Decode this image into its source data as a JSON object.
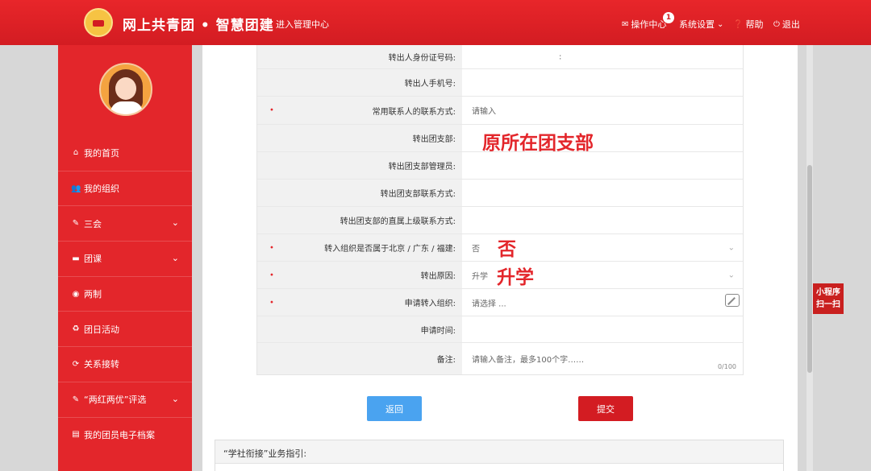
{
  "header": {
    "site_title": "网上共青团 • 智慧团建",
    "enter_admin": "进入管理中心",
    "ops_center": "操作中心",
    "ops_badge": "1",
    "settings": "系统设置",
    "help": "帮助",
    "logout": "退出"
  },
  "sidebar": {
    "items": [
      {
        "label": "我的首页",
        "icon": "home-icon"
      },
      {
        "label": "我的组织",
        "icon": "users-icon"
      },
      {
        "label": "三会",
        "icon": "edit-icon"
      },
      {
        "label": "团课",
        "icon": "folder-icon"
      },
      {
        "label": "两制",
        "icon": "circle-icon"
      },
      {
        "label": "团日活动",
        "icon": "recycle-icon"
      },
      {
        "label": "关系接转",
        "icon": "refresh-icon"
      },
      {
        "label": "“两红两优”评选",
        "icon": "edit-icon"
      },
      {
        "label": "我的团员电子档案",
        "icon": "file-icon"
      }
    ]
  },
  "form": {
    "rows": [
      {
        "label": "转出人身份证号码:",
        "value": ":"
      },
      {
        "label": "转出人手机号:",
        "value": ""
      },
      {
        "label": "常用联系人的联系方式:",
        "value": "请输入",
        "required": true
      },
      {
        "label": "转出团支部:",
        "value": ""
      },
      {
        "label": "转出团支部管理员:",
        "value": ""
      },
      {
        "label": "转出团支部联系方式:",
        "value": ""
      },
      {
        "label": "转出团支部的直属上级联系方式:",
        "value": ""
      },
      {
        "label": "转入组织是否属于北京 / 广东 / 福建:",
        "value": "否",
        "required": true
      },
      {
        "label": "转出原因:",
        "value": "升学",
        "required": true
      },
      {
        "label": "申请转入组织:",
        "value": "请选择 ...",
        "required": true
      },
      {
        "label": "申请时间:",
        "value": ""
      },
      {
        "label": "备注:",
        "value": "请输入备注，最多100个字……"
      }
    ],
    "remark_counter": "0/100",
    "annotations": {
      "branch": "原所在团支部",
      "no": "否",
      "reason": "升学"
    }
  },
  "buttons": {
    "back": "返回",
    "submit": "提交"
  },
  "guide": {
    "title": "“学社衔接”业务指引:"
  },
  "mini_program": {
    "line1": "小程序",
    "line2": "扫一扫"
  },
  "colors": {
    "brand_red": "#e3262b",
    "back_blue": "#4aa3f0"
  }
}
